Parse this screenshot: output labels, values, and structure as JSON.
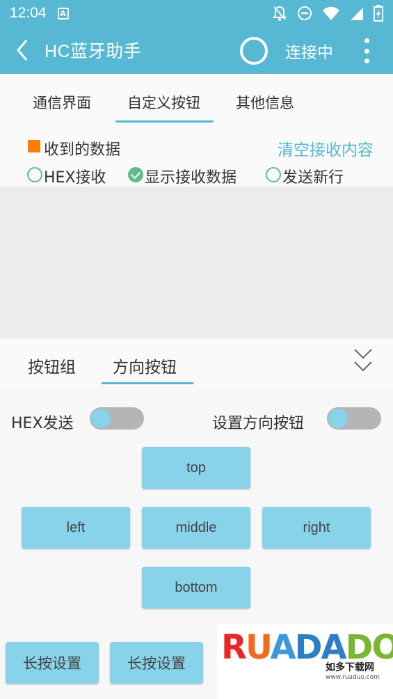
{
  "status_bar": {
    "time": "12:04",
    "app_badge": "A",
    "icons": [
      "mute-notifications-icon",
      "do-not-disturb-icon",
      "wifi-icon",
      "signal-icon",
      "battery-icon"
    ]
  },
  "app_bar": {
    "title": "HC蓝牙助手",
    "status": "连接中",
    "colors": {
      "primary": "#56b8d3"
    }
  },
  "top_tabs": [
    {
      "label": "通信界面",
      "selected": false
    },
    {
      "label": "自定义按钮",
      "selected": true
    },
    {
      "label": "其他信息",
      "selected": false
    }
  ],
  "receive": {
    "label": "收到的数据",
    "clear_label": "清空接收内容",
    "options": [
      {
        "label": "HEX接收",
        "checked": false
      },
      {
        "label": "显示接收数据",
        "checked": true
      },
      {
        "label": "发送新行",
        "checked": false
      }
    ]
  },
  "bottom_tabs": [
    {
      "label": "按钮组",
      "selected": false
    },
    {
      "label": "方向按钮",
      "selected": true
    }
  ],
  "settings": {
    "hex_send_label": "HEX发送",
    "hex_send_on": false,
    "set_direction_label": "设置方向按钮",
    "set_direction_on": false
  },
  "direction_buttons": {
    "top": "top",
    "left": "left",
    "middle": "middle",
    "right": "right",
    "bottom": "bottom"
  },
  "long_press_buttons": [
    "长按设置",
    "长按设置"
  ],
  "watermark": {
    "logo_text": "RUADADO",
    "cn_name": "如多下载网",
    "url": "www.ruaduo.com"
  }
}
